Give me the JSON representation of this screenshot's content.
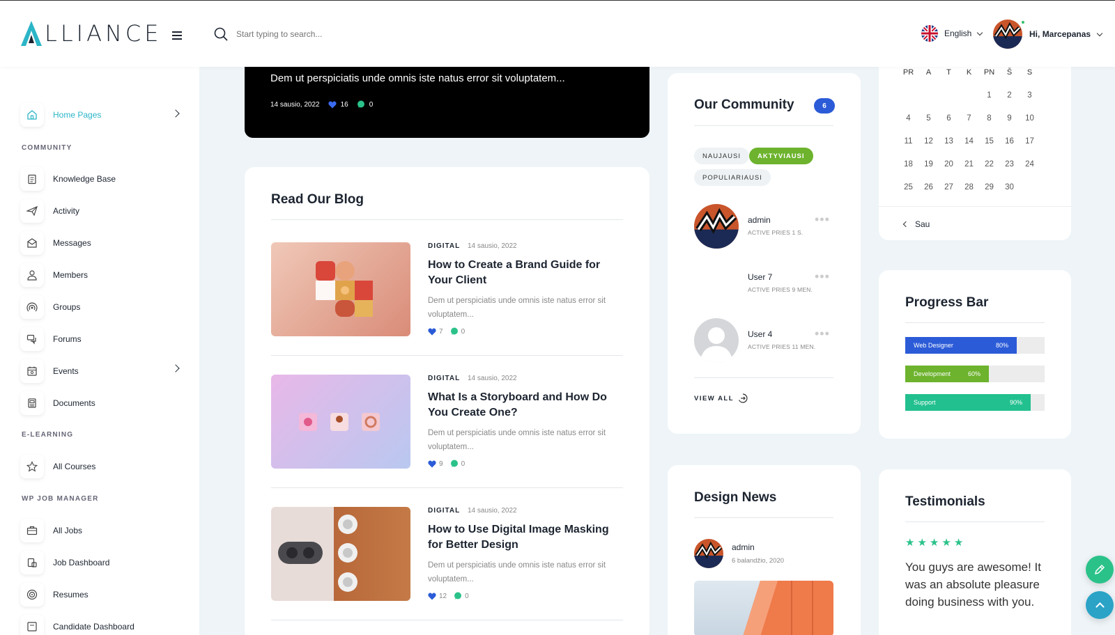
{
  "header": {
    "logo_text": "LLIANCE",
    "search_placeholder": "Start typing to search...",
    "language": "English",
    "greeting": "Hi,",
    "username": "Marcepanas"
  },
  "sidebar": {
    "home": "Home Pages",
    "section_community": "COMMUNITY",
    "community_items": [
      "Knowledge Base",
      "Activity",
      "Messages",
      "Members",
      "Groups",
      "Forums",
      "Events",
      "Documents"
    ],
    "section_elearning": "E-LEARNING",
    "elearning_items": [
      "All Courses"
    ],
    "section_jobs": "WP JOB MANAGER",
    "job_items": [
      "All Jobs",
      "Job Dashboard",
      "Resumes",
      "Candidate Dashboard"
    ]
  },
  "featured": {
    "title": "Dem ut perspiciatis unde omnis iste natus error sit voluptatem...",
    "date": "14 sausio, 2022",
    "likes": "16",
    "comments": "0"
  },
  "blog": {
    "title": "Read Our Blog",
    "posts": [
      {
        "category": "DIGITAL",
        "date": "14 sausio, 2022",
        "title": "How to Create a Brand Guide for Your Client",
        "excerpt": "Dem ut perspiciatis unde omnis iste natus error sit voluptatem...",
        "likes": "7",
        "comments": "0"
      },
      {
        "category": "DIGITAL",
        "date": "14 sausio, 2022",
        "title": "What Is a Storyboard and How Do You Create One?",
        "excerpt": "Dem ut perspiciatis unde omnis iste natus error sit voluptatem...",
        "likes": "9",
        "comments": "0"
      },
      {
        "category": "DIGITAL",
        "date": "14 sausio, 2022",
        "title": "How to Use Digital Image Masking for Better Design",
        "excerpt": "Dem ut perspiciatis unde omnis iste natus error sit voluptatem...",
        "likes": "12",
        "comments": "0"
      }
    ]
  },
  "community": {
    "title": "Our Community",
    "count": "6",
    "filters": [
      "NAUJAUSI",
      "AKTYVIAUSI",
      "POPULIARIAUSI"
    ],
    "active_filter": "AKTYVIAUSI",
    "members": [
      {
        "name": "admin",
        "status": "ACTIVE PRIES 1 S."
      },
      {
        "name": "User 7",
        "status": "ACTIVE PRIES 9 MEN."
      },
      {
        "name": "User 4",
        "status": "ACTIVE PRIES 11 MEN."
      }
    ],
    "view_all": "VIEW ALL"
  },
  "calendar": {
    "weekdays": [
      "PR",
      "A",
      "T",
      "K",
      "PN",
      "Š",
      "S"
    ],
    "rows": [
      [
        "",
        "",
        "",
        "",
        "1",
        "2",
        "3"
      ],
      [
        "4",
        "5",
        "6",
        "7",
        "8",
        "9",
        "10"
      ],
      [
        "11",
        "12",
        "13",
        "14",
        "15",
        "16",
        "17"
      ],
      [
        "18",
        "19",
        "20",
        "21",
        "22",
        "23",
        "24"
      ],
      [
        "25",
        "26",
        "27",
        "28",
        "29",
        "30",
        ""
      ]
    ],
    "prev_label": "Sau"
  },
  "progress": {
    "title": "Progress Bar",
    "bars": [
      {
        "label": "Web Designer",
        "value": "80%",
        "fraction": 0.8,
        "color": "#2b5bd7"
      },
      {
        "label": "Development",
        "value": "60%",
        "fraction": 0.6,
        "color": "#6db32d"
      },
      {
        "label": "Support",
        "value": "90%",
        "fraction": 0.9,
        "color": "#22c08e"
      }
    ]
  },
  "news": {
    "title": "Design News",
    "author": "admin",
    "date": "6 balandžio, 2020"
  },
  "testimonials": {
    "title": "Testimonials",
    "rating": 5,
    "quote": "You guys are awesome! It was an absolute pleasure doing business with you."
  },
  "colors": {
    "accent": "#2bb5c7",
    "primary": "#2b5bd7",
    "green": "#6db32d",
    "teal": "#22c08e"
  }
}
